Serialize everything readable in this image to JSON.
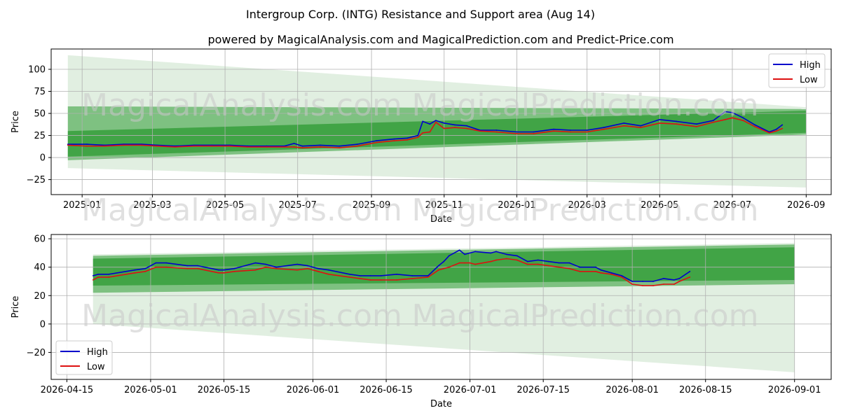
{
  "title": "Intergroup Corp. (INTG) Resistance and Support area (Aug 14)",
  "subtitle": "powered by MagicalAnalysis.com and MagicalPrediction.com and Predict-Price.com",
  "watermark": {
    "left": "MagicalAnalysis.com",
    "right": "MagicalPrediction.com"
  },
  "colors": {
    "high": "#0000cc",
    "low": "#dd1111",
    "band": "#2e9a33",
    "band_light": "#bcdcbc",
    "grid": "#b0b0b0"
  },
  "chart_data": [
    {
      "type": "line",
      "xlabel": "Date",
      "ylabel": "Price",
      "ylim": [
        -42,
        123
      ],
      "xlim": [
        "2024-12-06",
        "2026-09-22"
      ],
      "grid": true,
      "legend": "top-right",
      "yticks": [
        -25,
        0,
        25,
        50,
        75,
        100
      ],
      "xticks": [
        "2025-01",
        "2025-03",
        "2025-05",
        "2025-07",
        "2025-09",
        "2025-11",
        "2026-01",
        "2026-03",
        "2026-05",
        "2026-07",
        "2026-09"
      ],
      "xtick_dates": [
        "2025-01-01",
        "2025-03-01",
        "2025-05-01",
        "2025-07-01",
        "2025-09-01",
        "2025-11-01",
        "2026-01-01",
        "2026-03-01",
        "2026-05-01",
        "2026-07-01",
        "2026-09-01"
      ],
      "bands": {
        "dates": [
          "2024-12-20",
          "2026-09-01"
        ],
        "outer_upper": [
          116,
          57
        ],
        "outer_lower": [
          -12,
          -34
        ],
        "inner_upper": [
          58,
          55
        ],
        "inner_lower": [
          -3,
          26
        ],
        "core_upper": [
          30,
          53
        ],
        "core_lower": [
          1,
          28
        ]
      },
      "series": [
        {
          "name": "High",
          "x": [
            "2024-12-20",
            "2025-01-05",
            "2025-01-20",
            "2025-02-05",
            "2025-02-20",
            "2025-03-05",
            "2025-03-20",
            "2025-04-05",
            "2025-04-20",
            "2025-05-05",
            "2025-05-20",
            "2025-06-05",
            "2025-06-20",
            "2025-06-28",
            "2025-07-05",
            "2025-07-20",
            "2025-08-05",
            "2025-08-20",
            "2025-09-05",
            "2025-09-20",
            "2025-10-01",
            "2025-10-10",
            "2025-10-14",
            "2025-10-20",
            "2025-10-25",
            "2025-11-01",
            "2025-11-10",
            "2025-11-20",
            "2025-12-01",
            "2025-12-15",
            "2026-01-01",
            "2026-01-15",
            "2026-02-01",
            "2026-02-15",
            "2026-03-01",
            "2026-03-15",
            "2026-04-01",
            "2026-04-15",
            "2026-05-01",
            "2026-05-15",
            "2026-06-01",
            "2026-06-15",
            "2026-06-25",
            "2026-07-01",
            "2026-07-10",
            "2026-07-20",
            "2026-08-01",
            "2026-08-07",
            "2026-08-12"
          ],
          "values": [
            15,
            15,
            14,
            15,
            15,
            14,
            13,
            14,
            14,
            14,
            13,
            13,
            13,
            16,
            13,
            14,
            13,
            15,
            19,
            21,
            22,
            25,
            41,
            38,
            42,
            39,
            37,
            36,
            31,
            31,
            29,
            29,
            32,
            31,
            31,
            34,
            39,
            36,
            43,
            41,
            38,
            42,
            52,
            51,
            45,
            37,
            29,
            32,
            37
          ]
        },
        {
          "name": "Low",
          "x": [
            "2024-12-20",
            "2025-01-05",
            "2025-01-20",
            "2025-02-05",
            "2025-02-20",
            "2025-03-05",
            "2025-03-20",
            "2025-04-05",
            "2025-04-20",
            "2025-05-05",
            "2025-05-20",
            "2025-06-05",
            "2025-06-20",
            "2025-06-28",
            "2025-07-05",
            "2025-07-20",
            "2025-08-05",
            "2025-08-20",
            "2025-09-05",
            "2025-09-20",
            "2025-10-01",
            "2025-10-10",
            "2025-10-14",
            "2025-10-20",
            "2025-10-25",
            "2025-11-01",
            "2025-11-10",
            "2025-11-20",
            "2025-12-01",
            "2025-12-15",
            "2026-01-01",
            "2026-01-15",
            "2026-02-01",
            "2026-02-15",
            "2026-03-01",
            "2026-03-15",
            "2026-04-01",
            "2026-04-15",
            "2026-05-01",
            "2026-05-15",
            "2026-06-01",
            "2026-06-15",
            "2026-06-25",
            "2026-07-01",
            "2026-07-10",
            "2026-07-20",
            "2026-08-01",
            "2026-08-07",
            "2026-08-12"
          ],
          "values": [
            14,
            13,
            13,
            14,
            14,
            13,
            12,
            13,
            13,
            13,
            12,
            12,
            12,
            12,
            11,
            12,
            11,
            13,
            17,
            19,
            20,
            23,
            28,
            29,
            40,
            33,
            34,
            33,
            30,
            29,
            27,
            27,
            30,
            29,
            29,
            32,
            36,
            34,
            39,
            38,
            35,
            40,
            43,
            45,
            42,
            35,
            28,
            30,
            33
          ]
        }
      ]
    },
    {
      "type": "line",
      "xlabel": "Date",
      "ylabel": "Price",
      "ylim": [
        -39,
        63
      ],
      "xlim": [
        "2026-04-12",
        "2026-09-08"
      ],
      "grid": true,
      "legend": "bottom-left",
      "yticks": [
        -20,
        0,
        20,
        40,
        60
      ],
      "xticks": [
        "2026-04-15",
        "2026-05-01",
        "2026-05-15",
        "2026-06-01",
        "2026-06-15",
        "2026-07-01",
        "2026-07-15",
        "2026-08-01",
        "2026-08-15",
        "2026-09-01"
      ],
      "bands": {
        "dates": [
          "2026-04-20",
          "2026-09-01"
        ],
        "outer_upper": [
          49,
          57
        ],
        "outer_lower": [
          0,
          -34
        ],
        "inner_upper": [
          48,
          56
        ],
        "inner_lower": [
          22,
          28
        ],
        "core_upper": [
          46,
          54
        ],
        "core_lower": [
          27,
          31
        ]
      },
      "series": [
        {
          "name": "High",
          "x": [
            "2026-04-20",
            "2026-04-21",
            "2026-04-23",
            "2026-04-28",
            "2026-04-30",
            "2026-05-02",
            "2026-05-04",
            "2026-05-08",
            "2026-05-10",
            "2026-05-14",
            "2026-05-15",
            "2026-05-17",
            "2026-05-21",
            "2026-05-23",
            "2026-05-25",
            "2026-05-29",
            "2026-05-31",
            "2026-06-02",
            "2026-06-04",
            "2026-06-08",
            "2026-06-10",
            "2026-06-12",
            "2026-06-14",
            "2026-06-17",
            "2026-06-20",
            "2026-06-23",
            "2026-06-25",
            "2026-06-26",
            "2026-06-27",
            "2026-06-29",
            "2026-06-30",
            "2026-07-01",
            "2026-07-02",
            "2026-07-05",
            "2026-07-06",
            "2026-07-08",
            "2026-07-10",
            "2026-07-12",
            "2026-07-14",
            "2026-07-16",
            "2026-07-18",
            "2026-07-20",
            "2026-07-22",
            "2026-07-25",
            "2026-07-26",
            "2026-07-28",
            "2026-07-30",
            "2026-08-01",
            "2026-08-03",
            "2026-08-05",
            "2026-08-07",
            "2026-08-09",
            "2026-08-10",
            "2026-08-12"
          ],
          "values": [
            34,
            35,
            35,
            38,
            39,
            43,
            43,
            41,
            41,
            38,
            38,
            39,
            43,
            42,
            40,
            42,
            41,
            39,
            38,
            35,
            34,
            34,
            34,
            35,
            34,
            34,
            41,
            44,
            48,
            52,
            49,
            50,
            51,
            50,
            51,
            49,
            48,
            44,
            45,
            44,
            43,
            43,
            40,
            40,
            38,
            36,
            34,
            30,
            30,
            30,
            32,
            31,
            32,
            37
          ]
        },
        {
          "name": "Low",
          "x": [
            "2026-04-20",
            "2026-04-21",
            "2026-04-23",
            "2026-04-28",
            "2026-04-30",
            "2026-05-02",
            "2026-05-04",
            "2026-05-08",
            "2026-05-10",
            "2026-05-14",
            "2026-05-15",
            "2026-05-17",
            "2026-05-21",
            "2026-05-23",
            "2026-05-25",
            "2026-05-29",
            "2026-05-31",
            "2026-06-02",
            "2026-06-04",
            "2026-06-08",
            "2026-06-10",
            "2026-06-12",
            "2026-06-14",
            "2026-06-17",
            "2026-06-20",
            "2026-06-23",
            "2026-06-25",
            "2026-06-26",
            "2026-06-27",
            "2026-06-29",
            "2026-06-30",
            "2026-07-01",
            "2026-07-02",
            "2026-07-05",
            "2026-07-06",
            "2026-07-08",
            "2026-07-10",
            "2026-07-12",
            "2026-07-14",
            "2026-07-16",
            "2026-07-18",
            "2026-07-20",
            "2026-07-22",
            "2026-07-25",
            "2026-07-26",
            "2026-07-28",
            "2026-07-30",
            "2026-08-01",
            "2026-08-03",
            "2026-08-05",
            "2026-08-07",
            "2026-08-09",
            "2026-08-10",
            "2026-08-12"
          ],
          "values": [
            31,
            33,
            33,
            36,
            37,
            40,
            40,
            39,
            39,
            36,
            36,
            37,
            38,
            40,
            39,
            38,
            39,
            37,
            35,
            33,
            32,
            31,
            31,
            31,
            32,
            33,
            38,
            39,
            40,
            43,
            43,
            43,
            42,
            44,
            45,
            46,
            45,
            42,
            42,
            41,
            40,
            39,
            37,
            37,
            36,
            35,
            33,
            28,
            27,
            27,
            28,
            28,
            30,
            33
          ]
        }
      ]
    }
  ]
}
